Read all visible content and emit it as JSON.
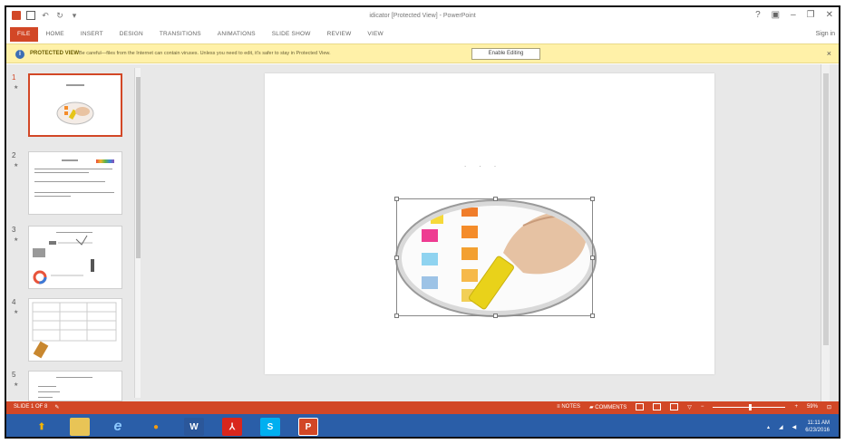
{
  "window": {
    "title": "idicator [Protected View] - PowerPoint",
    "sign_in": "Sign in"
  },
  "ribbon_tabs": [
    {
      "label": "FILE"
    },
    {
      "label": "HOME"
    },
    {
      "label": "INSERT"
    },
    {
      "label": "DESIGN"
    },
    {
      "label": "TRANSITIONS"
    },
    {
      "label": "ANIMATIONS"
    },
    {
      "label": "SLIDE SHOW"
    },
    {
      "label": "REVIEW"
    },
    {
      "label": "VIEW"
    }
  ],
  "protected_bar": {
    "title": "PROTECTED VIEW",
    "message": "Be careful—files from the Internet can contain viruses. Unless you need to edit, it's safer to stay in Protected View.",
    "enable_button": "Enable Editing"
  },
  "slides": [
    {
      "number": "1"
    },
    {
      "number": "2"
    },
    {
      "number": "3"
    },
    {
      "number": "4"
    },
    {
      "number": "5"
    }
  ],
  "main_slide": {
    "placeholder": ". . ."
  },
  "status": {
    "slide_count": "SLIDE 1 OF 8",
    "notes": "NOTES",
    "comments": "COMMENTS",
    "zoom": "59%"
  },
  "taskbar": {
    "time": "11:11 AM",
    "date": "6/23/2016"
  },
  "colors": {
    "accent": "#d24726",
    "taskbar": "#2a5ea8",
    "protected_bar": "#fff1a8"
  }
}
